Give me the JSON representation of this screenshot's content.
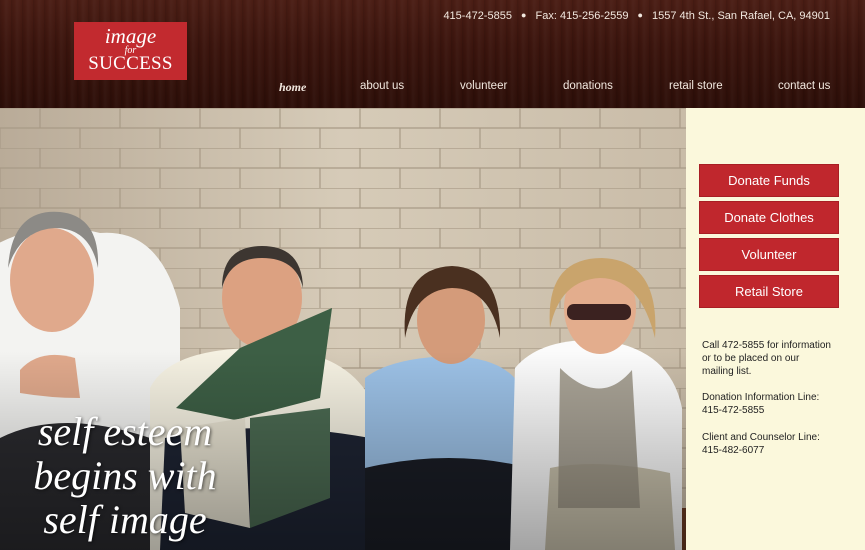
{
  "logo": {
    "line1": "image",
    "line2": "for",
    "line3": "SUCCESS"
  },
  "contact": {
    "phone": "415-472-5855",
    "fax": "Fax: 415-256-2559",
    "address": "1557 4th St., San Rafael, CA, 94901",
    "separator": "●"
  },
  "nav": {
    "home": "home",
    "about": "about us",
    "volunteer": "volunteer",
    "donations": "donations",
    "retail": "retail store",
    "contact": "contact us"
  },
  "hero": {
    "tagline_line1": "self esteem",
    "tagline_line2": "begins with",
    "tagline_line3": "self image"
  },
  "sidebar": {
    "buttons": [
      "Donate Funds",
      "Donate Clothes",
      "Volunteer",
      "Retail Store"
    ],
    "info1_line1": "Call 472-5855 for information",
    "info1_line2": "or to be placed on our",
    "info1_line3": "mailing list.",
    "info2_line1": "Donation Information Line:",
    "info2_line2": "415-472-5855",
    "info3_line1": "Client and Counselor Line:",
    "info3_line2": "415-482-6077"
  },
  "colors": {
    "header_bg": "#3a140d",
    "accent_red": "#c0272d",
    "sidebar_bg": "#fbf8dc"
  },
  "icons": [
    "photo-of-four-smiling-volunteers"
  ]
}
